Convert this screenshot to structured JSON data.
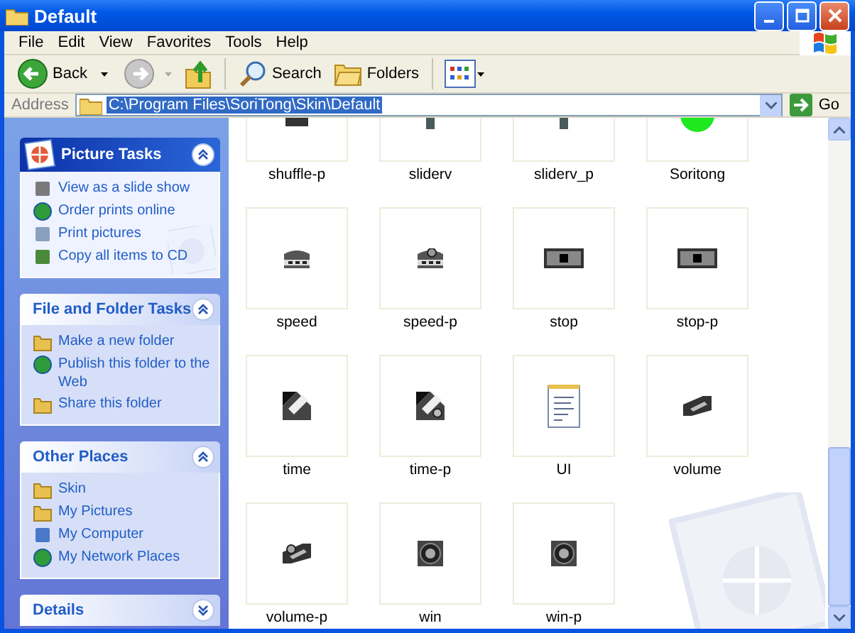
{
  "window": {
    "title": "Default"
  },
  "menu": [
    "File",
    "Edit",
    "View",
    "Favorites",
    "Tools",
    "Help"
  ],
  "toolbar": {
    "back": "Back",
    "search": "Search",
    "folders": "Folders"
  },
  "address": {
    "label": "Address",
    "value": "C:\\Program Files\\SoriTong\\Skin\\Default",
    "go": "Go"
  },
  "sidebar": {
    "panels": [
      {
        "title": "Picture Tasks",
        "kind": "special",
        "collapsed": false,
        "items": [
          {
            "label": "View as a slide show"
          },
          {
            "label": "Order prints online"
          },
          {
            "label": "Print pictures"
          },
          {
            "label": "Copy all items to CD"
          }
        ]
      },
      {
        "title": "File and Folder Tasks",
        "kind": "normal",
        "collapsed": false,
        "items": [
          {
            "label": "Make a new folder"
          },
          {
            "label": "Publish this folder to the Web"
          },
          {
            "label": "Share this folder"
          }
        ]
      },
      {
        "title": "Other Places",
        "kind": "normal",
        "collapsed": false,
        "items": [
          {
            "label": "Skin"
          },
          {
            "label": "My Pictures"
          },
          {
            "label": "My Computer"
          },
          {
            "label": "My Network Places"
          }
        ]
      },
      {
        "title": "Details",
        "kind": "normal",
        "collapsed": true
      }
    ]
  },
  "files": [
    {
      "name": "shuffle-p",
      "kind": "bar"
    },
    {
      "name": "sliderv",
      "kind": "slider"
    },
    {
      "name": "sliderv_p",
      "kind": "slider"
    },
    {
      "name": "Soritong",
      "kind": "circle"
    },
    {
      "name": "speed",
      "kind": "speed"
    },
    {
      "name": "speed-p",
      "kind": "speed-p"
    },
    {
      "name": "stop",
      "kind": "stop"
    },
    {
      "name": "stop-p",
      "kind": "stop"
    },
    {
      "name": "time",
      "kind": "time"
    },
    {
      "name": "time-p",
      "kind": "time-p"
    },
    {
      "name": "UI",
      "kind": "notepad"
    },
    {
      "name": "volume",
      "kind": "volume"
    },
    {
      "name": "volume-p",
      "kind": "volume-p"
    },
    {
      "name": "win",
      "kind": "win"
    },
    {
      "name": "win-p",
      "kind": "win"
    }
  ]
}
